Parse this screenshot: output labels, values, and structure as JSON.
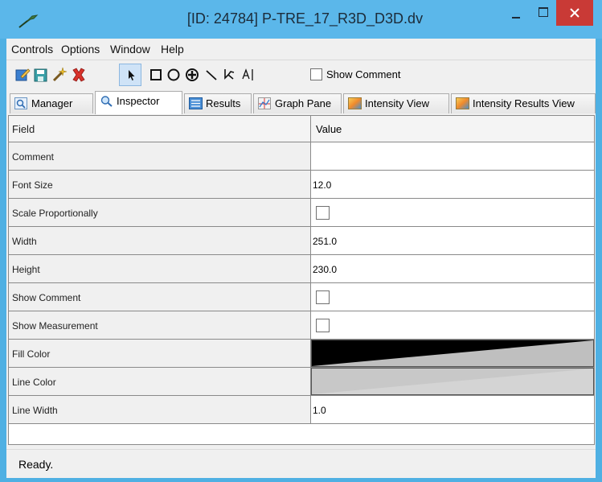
{
  "window": {
    "title": "[ID: 24784] P-TRE_17_R3D_D3D.dv",
    "minimize_icon": "minimize-icon",
    "maximize_icon": "maximize-icon",
    "close_icon": "close-icon"
  },
  "menu": [
    "Controls",
    "Options",
    "Window",
    "Help"
  ],
  "toolbar": {
    "icons": [
      "edit-icon",
      "save-icon",
      "magic-wand-icon",
      "delete-icon",
      "pointer-icon",
      "rectangle-icon",
      "circle-icon",
      "crosshair-icon",
      "line-icon",
      "polyline-icon",
      "text-icon"
    ],
    "show_comment_label": "Show Comment",
    "show_comment_checked": false
  },
  "tabs": [
    {
      "label": "Manager",
      "icon": "magnifier-icon",
      "active": false
    },
    {
      "label": "Inspector",
      "icon": "magnifier-icon",
      "active": true
    },
    {
      "label": "Results",
      "icon": "list-icon",
      "active": false
    },
    {
      "label": "Graph Pane",
      "icon": "graph-icon",
      "active": false
    },
    {
      "label": "Intensity View",
      "icon": "intensity-icon",
      "active": false
    },
    {
      "label": "Intensity Results View",
      "icon": "intensity-icon",
      "active": false
    }
  ],
  "table": {
    "headers": {
      "field": "Field",
      "value": "Value"
    },
    "rows": [
      {
        "field": "Comment",
        "value": "",
        "type": "text"
      },
      {
        "field": "Font Size",
        "value": "12.0",
        "type": "text"
      },
      {
        "field": "Scale Proportionally",
        "value": "",
        "type": "checkbox",
        "checked": false
      },
      {
        "field": "Width",
        "value": "251.0",
        "type": "text"
      },
      {
        "field": "Height",
        "value": "230.0",
        "type": "text"
      },
      {
        "field": "Show Comment",
        "value": "",
        "type": "checkbox",
        "checked": false
      },
      {
        "field": "Show Measurement",
        "value": "",
        "type": "checkbox",
        "checked": false
      },
      {
        "field": "Fill Color",
        "value": "",
        "type": "color",
        "color": "#000000",
        "alt_color": "#bfbfbf"
      },
      {
        "field": "Line Color",
        "value": "",
        "type": "color",
        "color": "#c8c8c8",
        "alt_color": "#d4d4d4"
      },
      {
        "field": "Line Width",
        "value": "1.0",
        "type": "text"
      }
    ]
  },
  "status": {
    "text": "Ready."
  }
}
